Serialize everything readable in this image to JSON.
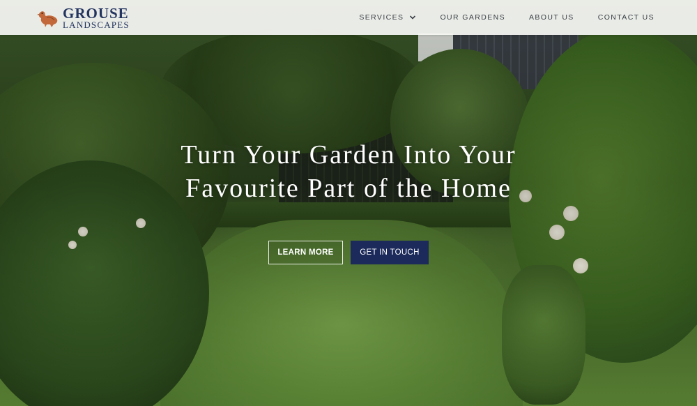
{
  "brand": {
    "name_line1": "GROUSE",
    "name_line2": "LANDSCAPES",
    "logo_icon": "grouse-bird-icon",
    "color": "#23345f",
    "bird_color": "#c2683a"
  },
  "nav": {
    "items": [
      {
        "label": "SERVICES",
        "has_dropdown": true
      },
      {
        "label": "OUR GARDENS"
      },
      {
        "label": "ABOUT US"
      },
      {
        "label": "CONTACT US"
      }
    ]
  },
  "hero": {
    "headline_line1": "Turn Your Garden Into Your",
    "headline_line2": "Favourite Part of the Home",
    "buttons": {
      "learn_more": "LEARN MORE",
      "get_in_touch": "GET IN TOUCH"
    },
    "accent_color": "#1b2a5a"
  }
}
